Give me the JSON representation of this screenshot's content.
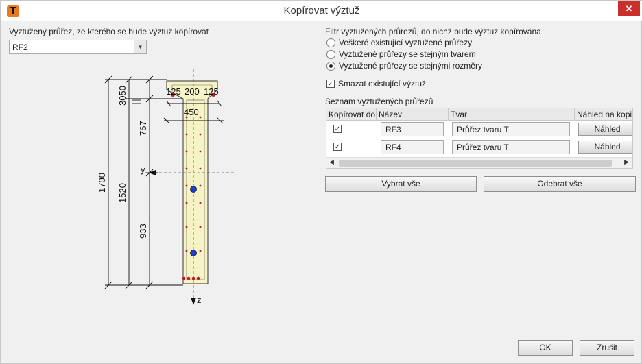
{
  "window": {
    "title": "Kopírovat výztuž",
    "app_icon": "T",
    "close_glyph": "✕"
  },
  "source": {
    "label": "Vyztužený průřez, ze kterého se bude výztuž kopírovat",
    "selected": "RF2"
  },
  "preview": {
    "dims_left": [
      "1700",
      "1520",
      "3050"
    ],
    "dims_mid": [
      "767",
      "933"
    ],
    "dims_top": [
      "125",
      "200",
      "125",
      "450"
    ],
    "axis_y": "y",
    "axis_z": "z"
  },
  "filter": {
    "label": "Filtr vyztužených průřezů, do nichž bude výztuž kopírována",
    "options": [
      {
        "label": "Veškeré existující vyztužené průřezy",
        "selected": false
      },
      {
        "label": "Vyztužené průřezy se stejným tvarem",
        "selected": false
      },
      {
        "label": "Vyztužené průřezy se stejnými rozměry",
        "selected": true
      }
    ]
  },
  "delete_existing": {
    "label": "Smazat existující výztuž",
    "checked": true
  },
  "list": {
    "label": "Seznam vyztužených průřezů",
    "columns": [
      "Kopírovat do",
      "Název",
      "Tvar",
      "Náhled na kopii"
    ],
    "rows": [
      {
        "copy": true,
        "name": "RF3",
        "shape": "Průřez tvaru T",
        "preview": "Náhled"
      },
      {
        "copy": true,
        "name": "RF4",
        "shape": "Průřez tvaru T",
        "preview": "Náhled"
      }
    ]
  },
  "buttons": {
    "select_all": "Vybrat vše",
    "deselect_all": "Odebrat vše",
    "ok": "OK",
    "cancel": "Zrušit"
  },
  "colors": {
    "close": "#c9302c",
    "app_icon": "#e8791e",
    "section_fill": "#f6f3c6",
    "rebar": "#c0161e",
    "tendon": "#1c3fd1"
  }
}
